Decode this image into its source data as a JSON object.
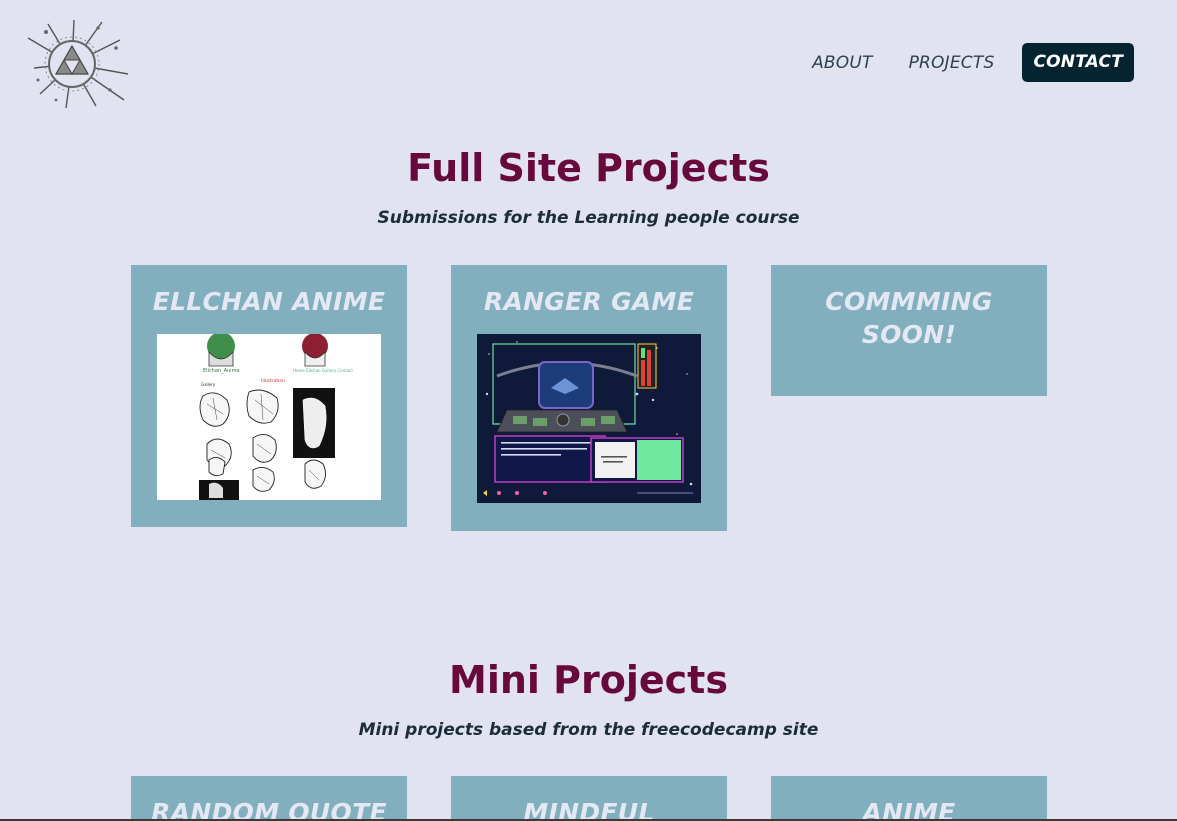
{
  "nav": {
    "about": "ABOUT",
    "projects": "PROJECTS",
    "contact": "CONTACT"
  },
  "full_site": {
    "title": "Full Site Projects",
    "subtitle": "Submissions for the Learning people course",
    "cards": [
      {
        "title": "ELLCHAN ANIME"
      },
      {
        "title": "RANGER GAME"
      },
      {
        "title": "COMMMING SOON!"
      }
    ]
  },
  "mini": {
    "title": "Mini Projects",
    "subtitle": "Mini projects based from the freecodecamp site",
    "cards": [
      {
        "title": "RANDOM QUOTE"
      },
      {
        "title": "MINDFUL"
      },
      {
        "title": "ANIME"
      }
    ]
  },
  "colors": {
    "background": "#e1e4f0",
    "card": "#82afbe",
    "heading": "#67093c",
    "contact_button": "#042431"
  }
}
